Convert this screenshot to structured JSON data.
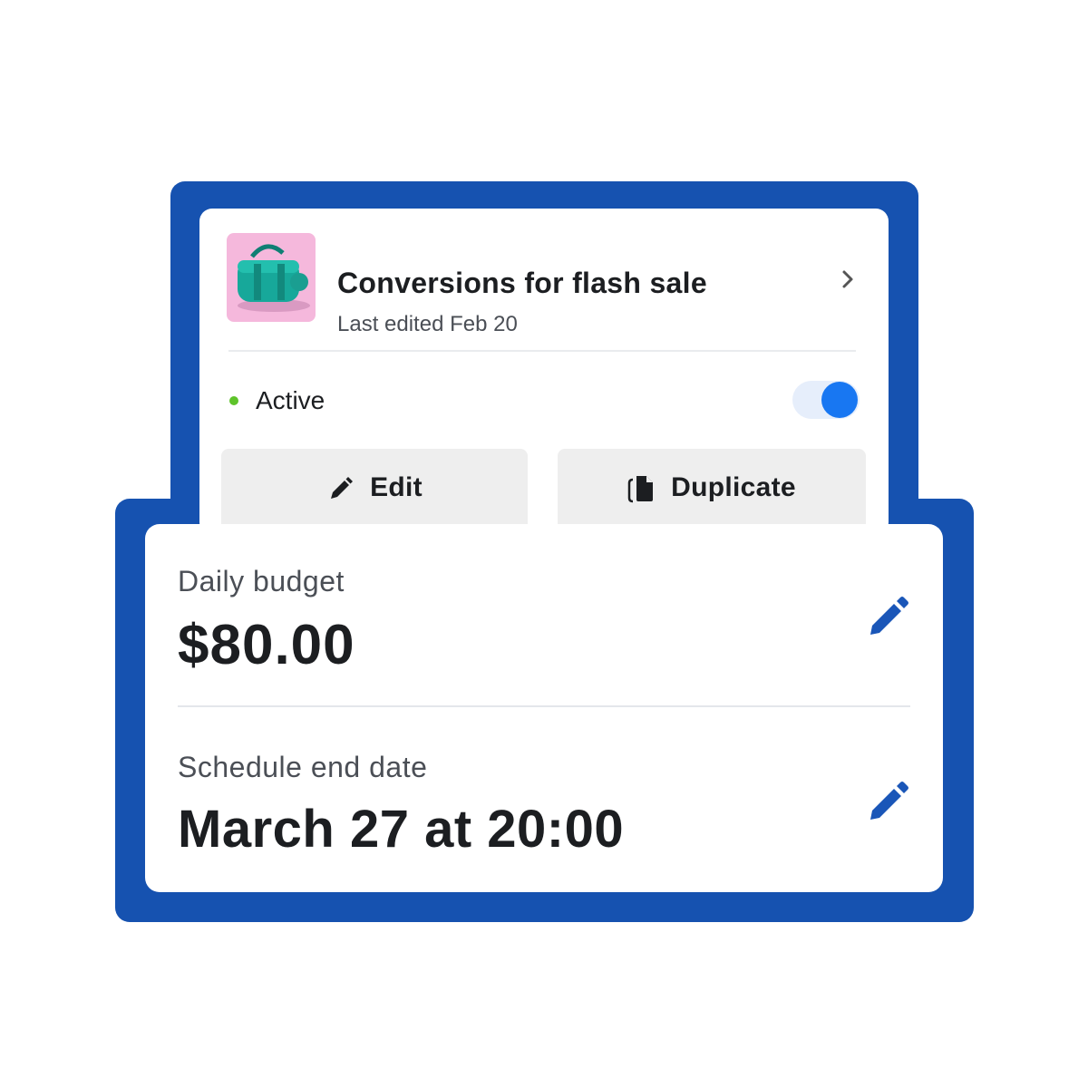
{
  "campaign": {
    "title": "Conversions for flash sale",
    "subtitle": "Last edited Feb 20",
    "thumbnail_icon": "duffel-bag-icon",
    "status_label": "Active",
    "status_color": "#5ec32a",
    "toggle_on": true
  },
  "actions": {
    "edit_label": "Edit",
    "duplicate_label": "Duplicate"
  },
  "settings": {
    "budget_label": "Daily budget",
    "budget_value": "$80.00",
    "end_label": "Schedule end date",
    "end_value": "March 27 at 20:00"
  },
  "colors": {
    "frame": "#1652b0",
    "accent": "#1877f2",
    "pencil": "#1a56b8",
    "thumbnail_bg": "#f5b8dc",
    "bag": "#17a89a"
  }
}
